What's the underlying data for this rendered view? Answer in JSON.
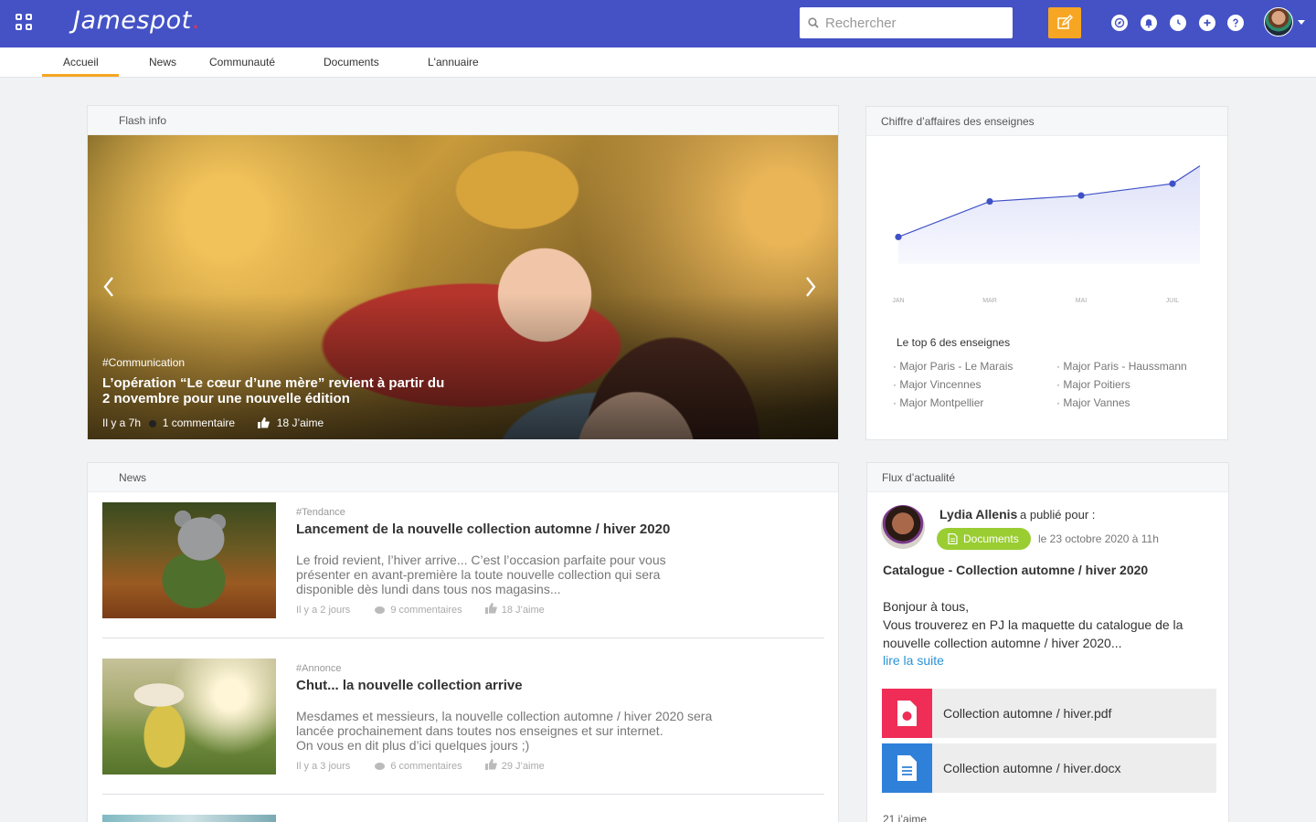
{
  "app": {
    "logo": "Jamespot",
    "logo_dot": ".",
    "accent": "#4452c5",
    "highlight": "#f6a623"
  },
  "search": {
    "placeholder": "Rechercher"
  },
  "nav": {
    "items": [
      "Accueil",
      "News",
      "Communauté",
      "Documents",
      "L'annuaire"
    ],
    "active": "Accueil"
  },
  "flash": {
    "heading": "Flash info",
    "tag": "#Communication",
    "title": "L’opération “Le cœur d’une mère” revient à partir du 2 novembre pour une nouvelle édition",
    "time": "Il y a 7h",
    "comments": "1 commentaire",
    "likes": "18 J’aime"
  },
  "chart_card": {
    "heading": "Chiffre d’affaires des enseignes",
    "top_title": "Le top 6 des enseignes",
    "top": [
      "Major Paris - Le Marais",
      "Major Paris - Haussmann",
      "Major Vincennes",
      "Major Poitiers",
      "Major Montpellier",
      "Major Vannes"
    ]
  },
  "chart_data": {
    "type": "area",
    "categories": [
      "JAN",
      "MAR",
      "MAI",
      "JUIL"
    ],
    "x": [
      0,
      2,
      4,
      6,
      6.6
    ],
    "values": [
      38,
      62,
      66,
      74,
      86
    ],
    "ylim": [
      0,
      100
    ],
    "markers": [
      true,
      true,
      true,
      true,
      false
    ],
    "grid": false,
    "color": "#3f51c6"
  },
  "news": {
    "heading": "News",
    "items": [
      {
        "tag": "#Tendance",
        "title": "Lancement de la nouvelle collection automne / hiver 2020",
        "lines": [
          "Le froid revient, l’hiver arrive... C’est l’occasion parfaite pour vous",
          "présenter en avant-première la toute nouvelle collection qui sera",
          "disponible dès lundi dans tous nos magasins..."
        ],
        "time": "Il y a 2 jours",
        "comments": "9 commentaires",
        "likes": "18 J’aime"
      },
      {
        "tag": "#Annonce",
        "title": "Chut... la nouvelle collection arrive",
        "lines": [
          "Mesdames et messieurs, la nouvelle collection automne / hiver 2020 sera",
          "lancée prochainement dans toutes nos enseignes et sur internet.",
          "On vous en dit plus d’ici quelques jours ;)"
        ],
        "time": "Il y a 3 jours",
        "comments": "6 commentaires",
        "likes": "29 J’aime"
      }
    ]
  },
  "flux": {
    "heading": "Flux d’actualité",
    "author": "Lydia Allenis",
    "published_for": "a publié pour :",
    "badge": "Documents",
    "date": "le 23 octobre 2020 à 11h",
    "post_title": "Catalogue - Collection automne / hiver 2020",
    "body": [
      "Bonjour à tous,",
      "Vous trouverez en PJ la maquette du catalogue de la",
      "nouvelle collection automne / hiver 2020..."
    ],
    "read_more": "lire la suite",
    "files": [
      {
        "name": "Collection automne / hiver.pdf",
        "icon": "pdf-icon",
        "color": "#ef2d56"
      },
      {
        "name": "Collection automne / hiver.docx",
        "icon": "doc-icon",
        "color": "#2f80d9"
      }
    ],
    "likes": "21 j’aime"
  }
}
